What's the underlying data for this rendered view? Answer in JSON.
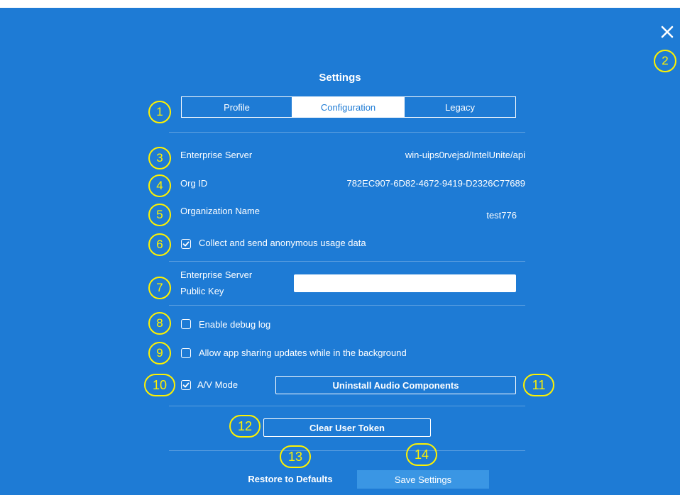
{
  "dialog": {
    "title": "Settings",
    "close_icon": "close-icon"
  },
  "tabs": [
    {
      "label": "Profile",
      "active": false
    },
    {
      "label": "Configuration",
      "active": true
    },
    {
      "label": "Legacy",
      "active": false
    }
  ],
  "rows": {
    "enterprise_server": {
      "label": "Enterprise Server",
      "value": "win-uips0rvejsd/IntelUnite/api"
    },
    "org_id": {
      "label": "Org ID",
      "value": "782EC907-6D82-4672-9419-D2326C77689"
    },
    "org_name": {
      "label": "Organization Name",
      "value": "test776"
    }
  },
  "options": {
    "usage_data": {
      "label": "Collect and send anonymous usage data",
      "checked": true
    },
    "public_key": {
      "label_line1": "Enterprise Server",
      "label_line2": "Public Key",
      "value": ""
    },
    "debug_log": {
      "label": "Enable debug log",
      "checked": false
    },
    "app_sharing": {
      "label": "Allow app sharing updates while in the background",
      "checked": false
    },
    "av_mode": {
      "label": "A/V Mode",
      "checked": true
    }
  },
  "buttons": {
    "uninstall_audio": "Uninstall Audio Components",
    "clear_token": "Clear User Token",
    "restore_defaults": "Restore to Defaults",
    "save_settings": "Save Settings"
  },
  "markers": [
    "1",
    "2",
    "3",
    "4",
    "5",
    "6",
    "7",
    "8",
    "9",
    "10",
    "11",
    "12",
    "13",
    "14"
  ],
  "colors": {
    "background": "#1e7bd5",
    "marker": "#fff200",
    "save_button": "#3a96e4"
  }
}
